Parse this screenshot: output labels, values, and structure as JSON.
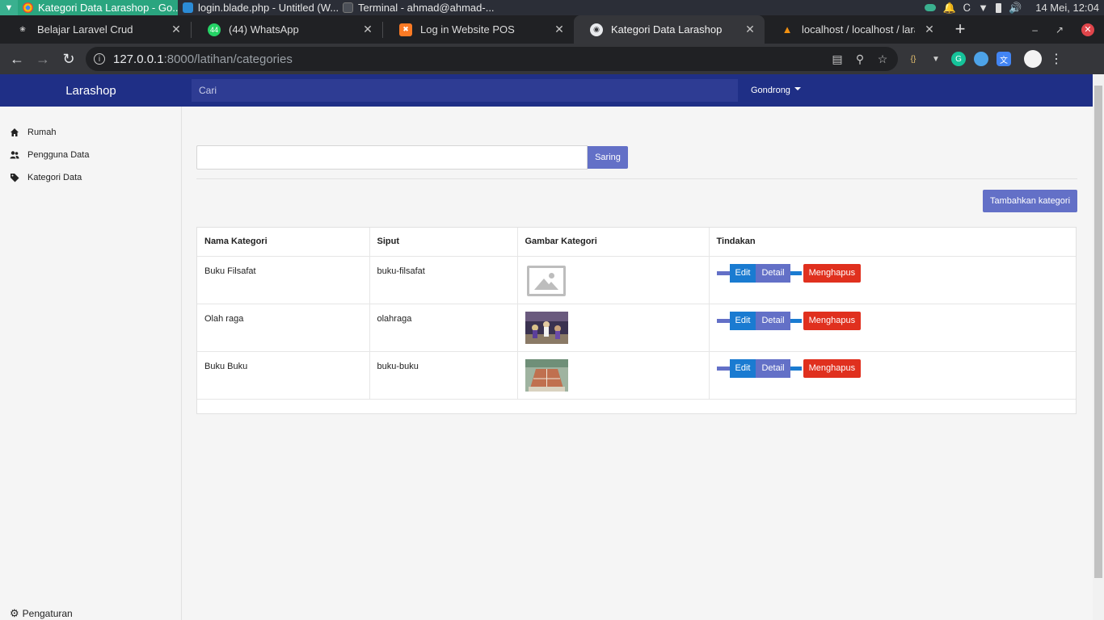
{
  "os": {
    "tasks": [
      {
        "label": "Kategori Data Larashop - Go...",
        "active": true
      },
      {
        "label": "login.blade.php - Untitled (W...",
        "active": false
      },
      {
        "label": "Terminal - ahmad@ahmad-...",
        "active": false
      }
    ],
    "clock": "14 Mei, 12:04"
  },
  "browser": {
    "tabs": [
      {
        "label": "Belajar Laravel Crud",
        "active": false
      },
      {
        "label": "(44) WhatsApp",
        "active": false
      },
      {
        "label": "Log in Website POS",
        "active": false
      },
      {
        "label": "Kategori Data Larashop",
        "active": true
      },
      {
        "label": "localhost / localhost / laravel-t",
        "active": false
      }
    ],
    "url_host": "127.0.0.1",
    "url_rest": ":8000/latihan/categories"
  },
  "app": {
    "brand": "Larashop",
    "search_placeholder": "Cari",
    "user": "Gondrong",
    "sidebar": [
      {
        "label": "Rumah",
        "icon": "home-icon"
      },
      {
        "label": "Pengguna Data",
        "icon": "users-icon"
      },
      {
        "label": "Kategori Data",
        "icon": "tag-icon"
      }
    ],
    "settings_label": "Pengaturan"
  },
  "main": {
    "filter_button": "Saring",
    "add_button": "Tambahkan kategori",
    "columns": [
      "Nama Kategori",
      "Siput",
      "Gambar Kategori",
      "Tindakan"
    ],
    "rows": [
      {
        "name": "Buku Filsafat",
        "slug": "buku-filsafat",
        "image": "placeholder"
      },
      {
        "name": "Olah raga",
        "slug": "olahraga",
        "image": "photo-sports"
      },
      {
        "name": "Buku Buku",
        "slug": "buku-buku",
        "image": "photo-court"
      }
    ],
    "edit_label": "Edit",
    "detail_label": "Detail",
    "delete_label": "Menghapus"
  },
  "colors": {
    "navbar": "#1f2f86",
    "primary": "#6370c7",
    "info": "#1a7bd1",
    "danger": "#e0301e"
  }
}
